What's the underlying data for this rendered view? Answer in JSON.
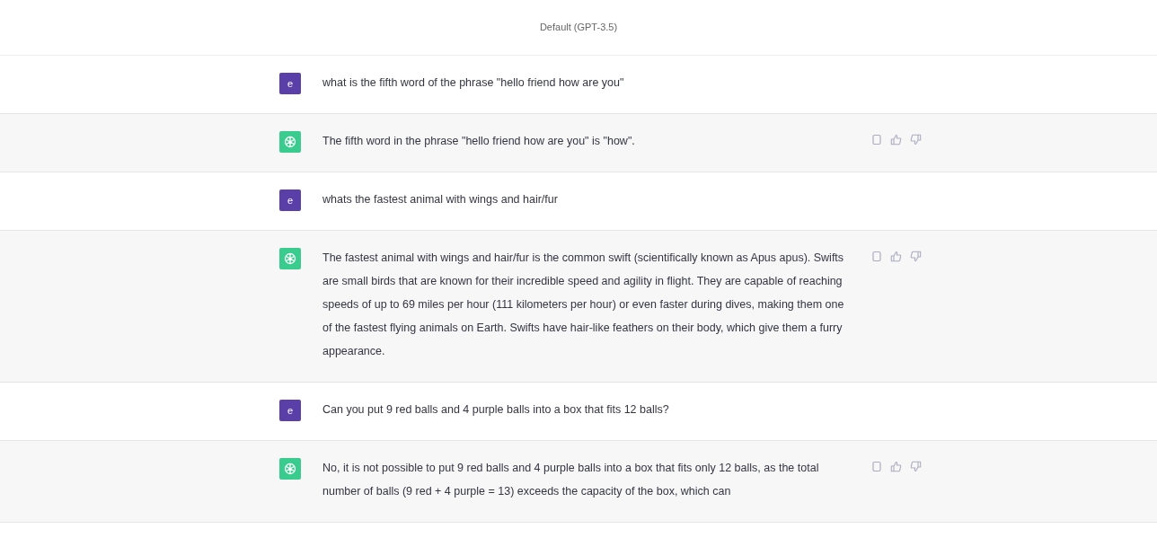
{
  "header": {
    "model": "Default (GPT-3.5)"
  },
  "messages": [
    {
      "kind": "user",
      "avatar": "e",
      "text": "what is the fifth word of the phrase \"hello friend how are you\""
    },
    {
      "kind": "assistant",
      "text": "The fifth word in the phrase \"hello friend how are you\" is \"how\"."
    },
    {
      "kind": "user",
      "avatar": "e",
      "text": "whats the fastest animal with wings and hair/fur"
    },
    {
      "kind": "assistant",
      "text": "The fastest animal with wings and hair/fur is the common swift (scientifically known as Apus apus). Swifts are small birds that are known for their incredible speed and agility in flight. They are capable of reaching speeds of up to 69 miles per hour (111 kilometers per hour) or even faster during dives, making them one of the fastest flying animals on Earth. Swifts have hair-like feathers on their body, which give them a furry appearance."
    },
    {
      "kind": "user",
      "avatar": "e",
      "text": "Can you put 9 red balls and 4 purple balls into a box that fits 12 balls?"
    },
    {
      "kind": "assistant",
      "text": "No, it is not possible to put 9 red balls and 4 purple balls into a box that fits only 12 balls, as the total number of balls (9 red + 4 purple = 13) exceeds the capacity of the box, which can"
    }
  ]
}
